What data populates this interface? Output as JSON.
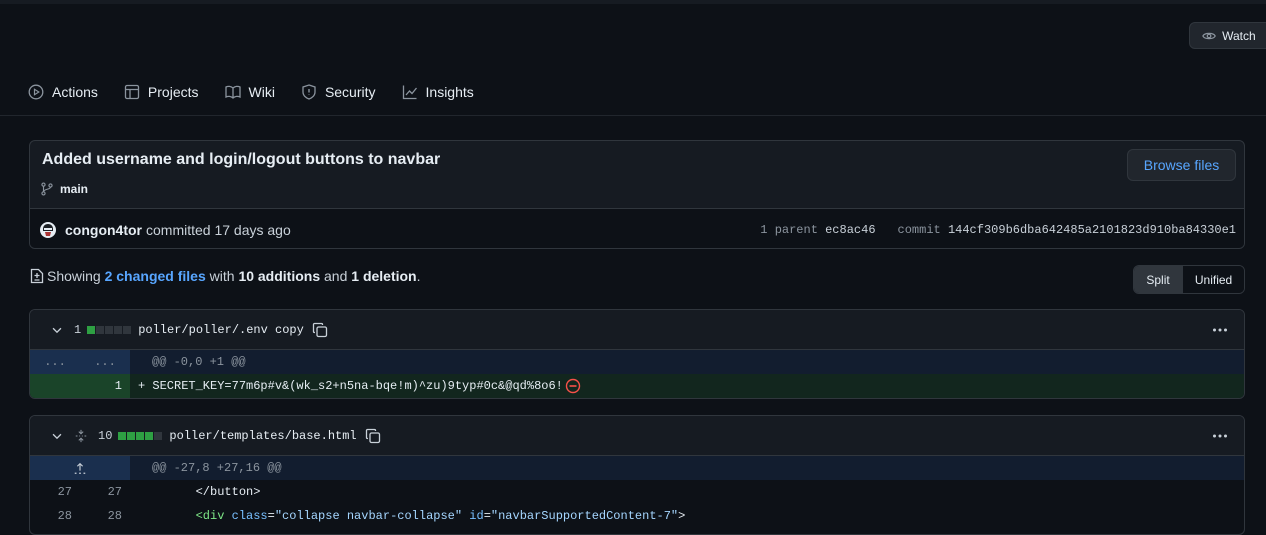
{
  "watch": {
    "label": "Watch"
  },
  "nav": {
    "items": [
      {
        "label": "Actions",
        "icon": "play-circle-icon"
      },
      {
        "label": "Projects",
        "icon": "table-icon"
      },
      {
        "label": "Wiki",
        "icon": "book-icon"
      },
      {
        "label": "Security",
        "icon": "shield-icon"
      },
      {
        "label": "Insights",
        "icon": "graph-icon"
      }
    ]
  },
  "commit": {
    "title": "Added username and login/logout buttons to navbar",
    "branch": "main",
    "browse_label": "Browse files",
    "author": "congon4tor",
    "committed_text": "committed 17 days ago",
    "parent_label": "1 parent",
    "parent_sha": "ec8ac46",
    "commit_label": "commit",
    "commit_sha": "144cf309b6dba642485a2101823d910ba84330e1"
  },
  "summary": {
    "showing": "Showing",
    "changed": "2 changed files",
    "with": "with",
    "additions": "10 additions",
    "and": "and",
    "deletions": "1 deletion",
    "period": "."
  },
  "view_toggle": {
    "split": "Split",
    "unified": "Unified"
  },
  "files": [
    {
      "count": "1",
      "path": "poller/poller/.env copy",
      "hunk_dots_left": "...",
      "hunk_dots_right": "...",
      "hunk": "@@ -0,0 +1 @@",
      "line_num": "1",
      "line_code": "+ SECRET_KEY=77m6p#v&(wk_s2+n5na-bqe!m)^zu)9typ#0c&@qd%8o6!"
    },
    {
      "count": "10",
      "path": "poller/templates/base.html",
      "hunk": "@@ -27,8 +27,16 @@",
      "lines": [
        {
          "old": "27",
          "new": "27",
          "indent": "        ",
          "text": "</button>"
        },
        {
          "old": "28",
          "new": "28",
          "indent": "        ",
          "pre": "<div ",
          "a1": "class",
          "eq1": "=",
          "s1": "\"collapse navbar-collapse\"",
          "sp": " ",
          "a2": "id",
          "eq2": "=",
          "s2": "\"navbarSupportedContent-7\"",
          "post": ">"
        }
      ]
    }
  ],
  "colors": {
    "accent": "#58a6ff",
    "add": "#2ea043",
    "bg": "#0d1117"
  }
}
